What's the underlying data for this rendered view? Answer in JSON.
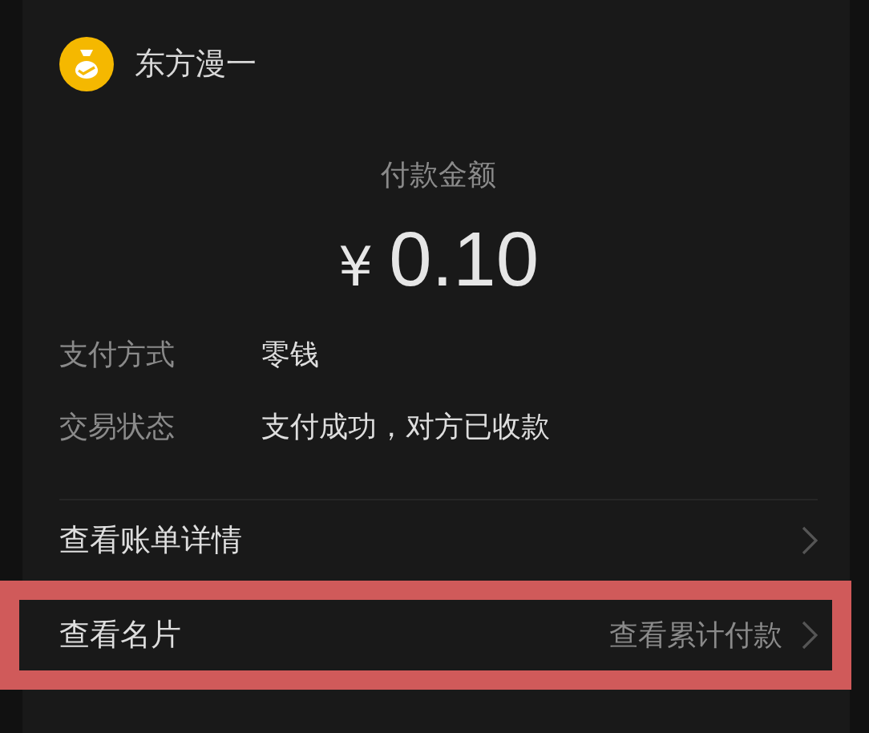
{
  "merchant": {
    "name": "东方漫一"
  },
  "payment": {
    "label": "付款金额",
    "currency": "¥",
    "amount": "0.10"
  },
  "details": [
    {
      "label": "支付方式",
      "value": "零钱"
    },
    {
      "label": "交易状态",
      "value": "支付成功，对方已收款"
    }
  ],
  "links": [
    {
      "label": "查看账单详情",
      "highlighted": false
    },
    {
      "label": "查看名片",
      "value": "查看累计付款",
      "highlighted": true
    }
  ]
}
